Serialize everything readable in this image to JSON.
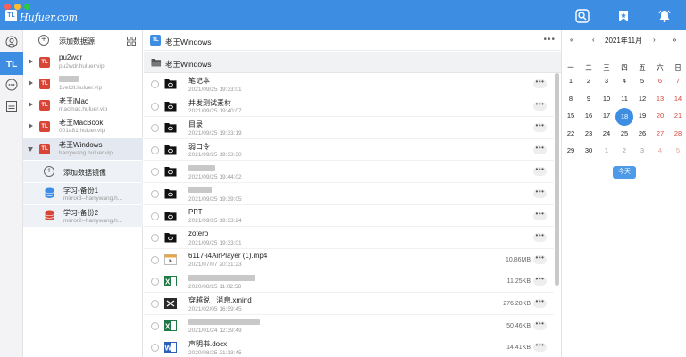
{
  "app": {
    "logo_text": "Hufuer.com",
    "logo_badge": "TL",
    "traffic_colors": [
      "#fe5f57",
      "#febc2e",
      "#28c840"
    ],
    "accent": "#3d8de3",
    "titlebar_icons": [
      "search-icon",
      "bookmark-icon",
      "bell-icon"
    ]
  },
  "rail": {
    "items": [
      "user-icon",
      "apps-icon",
      "chat-icon",
      "list-icon"
    ]
  },
  "sources": {
    "add_label": "添加数据源",
    "items": [
      {
        "name": "pu2wdr",
        "host": "pu2wdr.huluer.vip",
        "expanded": false,
        "selected": false
      },
      {
        "name": "",
        "host": "1velxlt.huluer.vip",
        "expanded": false,
        "selected": false
      },
      {
        "name": "老王iMac",
        "host": "macmac.huluer.vip",
        "expanded": false,
        "selected": false
      },
      {
        "name": "老王MacBook",
        "host": "001a81.huluer.vip",
        "expanded": false,
        "selected": false
      },
      {
        "name": "老王Windows",
        "host": "harrywang.huluer.vip",
        "expanded": true,
        "selected": true
      }
    ],
    "add_mirror_label": "添加数据镜像",
    "mirrors": [
      {
        "name": "学习-备份1",
        "host": "mirror3--harrywang.h...",
        "color": "#3d8de3"
      },
      {
        "name": "学习-备份2",
        "host": "mirror2--harrywang.h...",
        "color": "#d84436"
      }
    ]
  },
  "files": {
    "header_title": "老王Windows",
    "path": "老王Windows",
    "rows": [
      {
        "name": "笔记本",
        "date": "2021/09/25 19:33:01",
        "size": "",
        "type": "folder"
      },
      {
        "name": "并发测试素材",
        "date": "2021/09/25 19:40:07",
        "size": "",
        "type": "folder"
      },
      {
        "name": "目录",
        "date": "2021/09/25 19:33:19",
        "size": "",
        "type": "folder"
      },
      {
        "name": "弱口令",
        "date": "2021/09/25 19:33:30",
        "size": "",
        "type": "folder"
      },
      {
        "name": "",
        "date": "2021/09/25 19:44:02",
        "size": "",
        "type": "folder"
      },
      {
        "name": "",
        "date": "2021/09/25 19:39:05",
        "size": "",
        "type": "folder"
      },
      {
        "name": "PPT",
        "date": "2021/09/25 19:33:24",
        "size": "",
        "type": "folder"
      },
      {
        "name": "zotero",
        "date": "2021/09/25 19:33:01",
        "size": "",
        "type": "folder"
      },
      {
        "name": "6117-i4AirPlayer (1).mp4",
        "date": "2021/07/07 20:31:23",
        "size": "10.86MB",
        "type": "video"
      },
      {
        "name": "",
        "date": "2020/08/25 11:02:58",
        "size": "11.25KB",
        "type": "excel"
      },
      {
        "name": "穿越说 · 消息.xmind",
        "date": "2021/02/05 16:59:45",
        "size": "276.28KB",
        "type": "xmind"
      },
      {
        "name": "",
        "date": "2021/01/24 12:39:49",
        "size": "50.46KB",
        "type": "excel"
      },
      {
        "name": "声明书.docx",
        "date": "2020/08/25 21:13:45",
        "size": "14.41KB",
        "type": "word"
      }
    ]
  },
  "calendar": {
    "title": "2021年11月",
    "nav": {
      "prev_year": "«",
      "prev_month": "‹",
      "next_month": "›",
      "next_year": "»"
    },
    "weekdays": [
      "一",
      "二",
      "三",
      "四",
      "五",
      "六",
      "日"
    ],
    "weeks": [
      [
        "1",
        "2",
        "3",
        "4",
        "5",
        "6",
        "7"
      ],
      [
        "8",
        "9",
        "10",
        "11",
        "12",
        "13",
        "14"
      ],
      [
        "15",
        "16",
        "17",
        "18",
        "19",
        "20",
        "21"
      ],
      [
        "22",
        "23",
        "24",
        "25",
        "26",
        "27",
        "28"
      ],
      [
        "29",
        "30",
        "1",
        "2",
        "3",
        "4",
        "5"
      ]
    ],
    "today": "18",
    "today_button": "今天"
  }
}
